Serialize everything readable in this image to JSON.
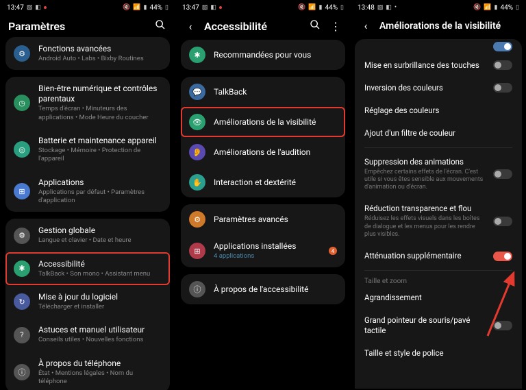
{
  "status": {
    "time1": "13:47",
    "time2": "13:47",
    "time3": "13:48",
    "battery": "44%"
  },
  "panel1": {
    "title": "Paramètres",
    "items": {
      "advanced": {
        "title": "Fonctions avancées",
        "sub": "Android Auto • Labs • Bixby Routines"
      },
      "wellbeing": {
        "title": "Bien-être numérique et contrôles parentaux",
        "sub": "Temps d'écran • Minuteurs des applications • Mode Heure du coucher"
      },
      "battery": {
        "title": "Batterie et maintenance appareil",
        "sub": "Stockage • Mémoire • Protection de l'appareil"
      },
      "apps": {
        "title": "Applications",
        "sub": "Applications par défaut • Paramètres d'application"
      },
      "general": {
        "title": "Gestion globale",
        "sub": "Langue et clavier • Date et heure"
      },
      "accessibility": {
        "title": "Accessibilité",
        "sub": "TalkBack • Son mono • Assistant menu"
      },
      "update": {
        "title": "Mise à jour du logiciel",
        "sub": "Télécharger et installer"
      },
      "tips": {
        "title": "Astuces et manuel utilisateur",
        "sub": "Conseils utiles • Nouvelles fonctions"
      },
      "about": {
        "title": "À propos du téléphone",
        "sub": "État • Mentions légales • Nom du téléphone"
      }
    }
  },
  "panel2": {
    "title": "Accessibilité",
    "items": {
      "recommended": "Recommandées pour vous",
      "talkback": "TalkBack",
      "visibility": "Améliorations de la visibilité",
      "hearing": "Améliorations de l'audition",
      "interaction": "Interaction et dextérité",
      "advanced": "Paramètres avancés",
      "installed": {
        "title": "Applications installées",
        "sub": "4 applications"
      },
      "about": "À propos de l'accessibilité"
    }
  },
  "panel3": {
    "title": "Améliorations de la visibilité",
    "items": {
      "highlight_buttons": "Mise en surbrillance des touches",
      "color_inversion": "Inversion des couleurs",
      "color_adjust": "Réglage des couleurs",
      "color_filter": "Ajout d'un filtre de couleur",
      "remove_anim": {
        "title": "Suppression des animations",
        "sub": "Empêchez certains effets de l'écran. C'est utile si vous êtes sensible aux mouvements d'animation ou d'écran."
      },
      "reduce_blur": {
        "title": "Réduction transparence et flou",
        "sub": "Réduisez les effets visuels dans les boîtes de dialogue et les menus pour les rendre plus visibles."
      },
      "extra_dim": "Atténuation supplémentaire",
      "section_zoom": "Taille et zoom",
      "magnification": "Agrandissement",
      "pointer": "Grand pointeur de souris/pavé tactile",
      "font": "Taille et style de police"
    }
  }
}
